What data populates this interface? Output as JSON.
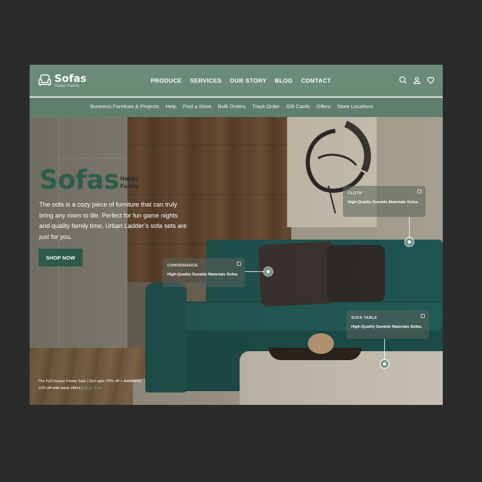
{
  "logo": {
    "name": "Sofas",
    "tagline": "Happy Family"
  },
  "main_nav": [
    "PRODUCE",
    "SERVICES",
    "OUR STORY",
    "BLOG",
    "CONTACT"
  ],
  "nav_icons": [
    "search-icon",
    "user-icon",
    "heart-icon"
  ],
  "sub_nav": [
    "Business Furniture & Projects",
    "Help",
    "Find a Store",
    "Bulk Orders",
    "Track Order",
    "Gift Cards",
    "Offers",
    "Store Locations"
  ],
  "hero": {
    "title": "Sofas",
    "sub_line1": "Happy",
    "sub_line2": "Family",
    "description": "The sofa is a cozy piece of furniture that can truly bring any room to life. Perfect for fun game nights and quality family time, Urban Ladder’s sofa sets are just for you.",
    "cta": "SHOP NOW"
  },
  "hotspots": [
    {
      "label": "CLOTH",
      "description": "High-Quality Durable Materials Sofas."
    },
    {
      "label": "CONVENIENCE",
      "description": "High-Quality Durable Materials Sofas."
    },
    {
      "label": "SOFA TABLE",
      "description": "High-Quality Durable Materials Sofas."
    }
  ],
  "promo": {
    "text": "The Full House Fiesta Sale | Get upto 70% off + Additional 10% off with bank offers |",
    "link": "Shop Now"
  },
  "colors": {
    "nav_bg": "#6b8b79",
    "subnav_bg": "#5f7f6d",
    "brand_green": "#2e5e4e",
    "page_bg": "#2b2b2b"
  }
}
